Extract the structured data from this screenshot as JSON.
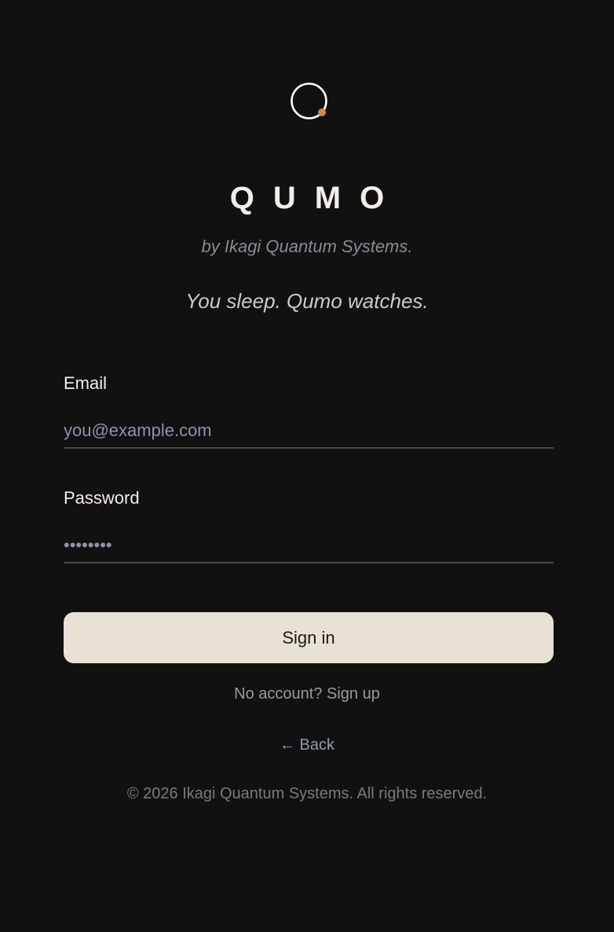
{
  "brand": {
    "logo_icon": "circle-orbit-icon",
    "logo_stroke_color": "#ffffff",
    "logo_dot_color": "#c8922e",
    "name": "QUMO",
    "byline": "by Ikagi Quantum Systems.",
    "tagline": "You sleep. Qumo watches."
  },
  "form": {
    "email": {
      "label": "Email",
      "placeholder": "you@example.com",
      "value": ""
    },
    "password": {
      "label": "Password",
      "placeholder": "••••••••",
      "value": ""
    },
    "submit_label": "Sign in",
    "submit_bg_color": "#e8e2d5"
  },
  "links": {
    "no_account": "No account?",
    "signup": "Sign up",
    "back_arrow": "←",
    "back": "Back"
  },
  "footer": {
    "copyright": "© 2026 Ikagi Quantum Systems. All rights reserved."
  },
  "colors": {
    "background": "#111111",
    "text_primary": "#f3efe6",
    "text_muted": "#8a8a92",
    "link_color": "#8f9cad"
  }
}
